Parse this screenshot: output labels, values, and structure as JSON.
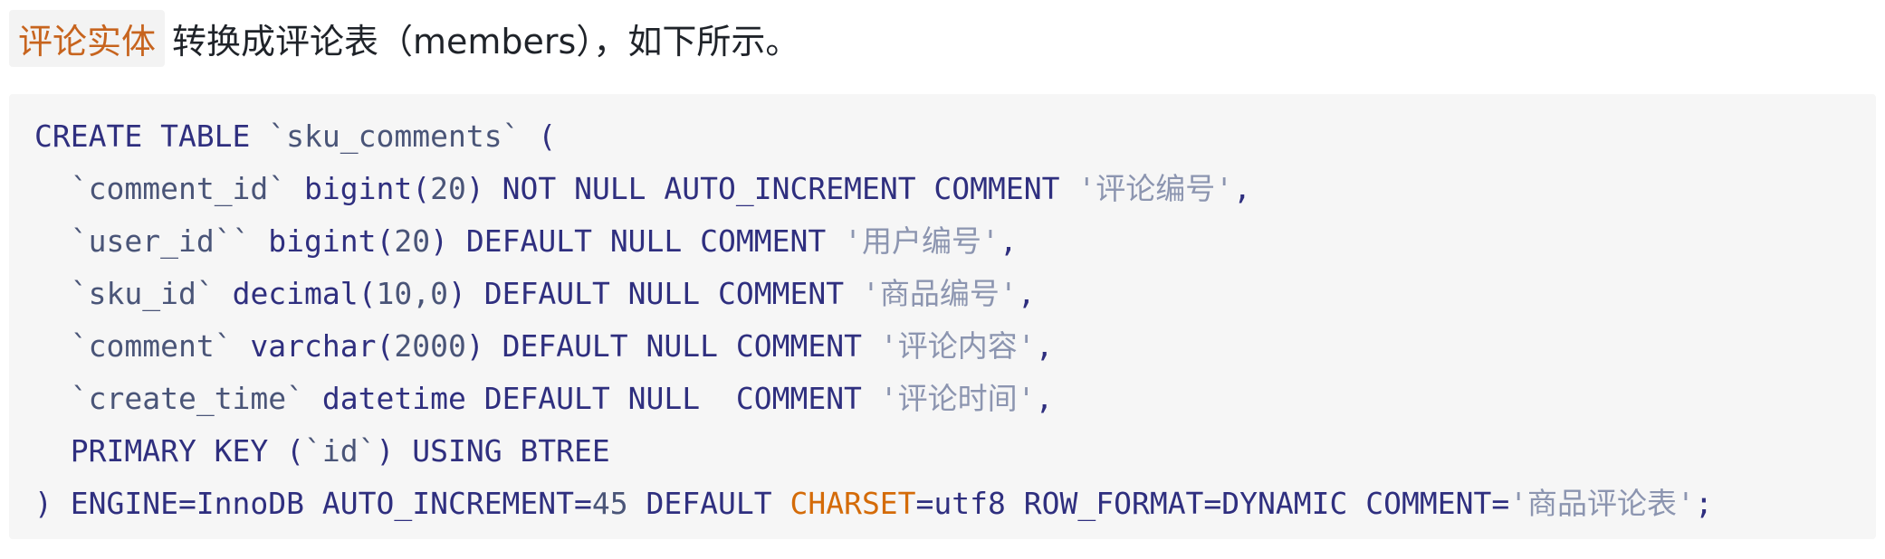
{
  "intro": {
    "inline_code": "评论实体",
    "rest": "转换成评论表（members），如下所示。"
  },
  "code": {
    "lines": [
      [
        {
          "t": "CREATE TABLE ",
          "c": "plain"
        },
        {
          "t": "`sku_comments`",
          "c": "ident"
        },
        {
          "t": " (",
          "c": "plain"
        }
      ],
      [
        {
          "t": "  ",
          "c": "plain"
        },
        {
          "t": "`comment_id`",
          "c": "ident"
        },
        {
          "t": " bigint(",
          "c": "plain"
        },
        {
          "t": "20",
          "c": "num"
        },
        {
          "t": ") NOT NULL AUTO_INCREMENT COMMENT ",
          "c": "plain"
        },
        {
          "t": "'评论编号'",
          "c": "str"
        },
        {
          "t": ",",
          "c": "plain"
        }
      ],
      [
        {
          "t": "  ",
          "c": "plain"
        },
        {
          "t": "`user_id``",
          "c": "ident"
        },
        {
          "t": " bigint(",
          "c": "plain"
        },
        {
          "t": "20",
          "c": "num"
        },
        {
          "t": ") DEFAULT NULL COMMENT ",
          "c": "plain"
        },
        {
          "t": "'用户编号'",
          "c": "str"
        },
        {
          "t": ",",
          "c": "plain"
        }
      ],
      [
        {
          "t": "  ",
          "c": "plain"
        },
        {
          "t": "`sku_id`",
          "c": "ident"
        },
        {
          "t": " decimal(",
          "c": "plain"
        },
        {
          "t": "10,0",
          "c": "num"
        },
        {
          "t": ") DEFAULT NULL COMMENT ",
          "c": "plain"
        },
        {
          "t": "'商品编号'",
          "c": "str"
        },
        {
          "t": ",",
          "c": "plain"
        }
      ],
      [
        {
          "t": "  ",
          "c": "plain"
        },
        {
          "t": "`comment`",
          "c": "ident"
        },
        {
          "t": " varchar(",
          "c": "plain"
        },
        {
          "t": "2000",
          "c": "num"
        },
        {
          "t": ") DEFAULT NULL COMMENT ",
          "c": "plain"
        },
        {
          "t": "'评论内容'",
          "c": "str"
        },
        {
          "t": ",",
          "c": "plain"
        }
      ],
      [
        {
          "t": "  ",
          "c": "plain"
        },
        {
          "t": "`create_time`",
          "c": "ident"
        },
        {
          "t": " datetime DEFAULT NULL  COMMENT ",
          "c": "plain"
        },
        {
          "t": "'评论时间'",
          "c": "str"
        },
        {
          "t": ",",
          "c": "plain"
        }
      ],
      [
        {
          "t": "  PRIMARY KEY (",
          "c": "plain"
        },
        {
          "t": "`id`",
          "c": "ident"
        },
        {
          "t": ") USING BTREE",
          "c": "plain"
        }
      ],
      [
        {
          "t": ") ENGINE=InnoDB AUTO_INCREMENT=",
          "c": "plain"
        },
        {
          "t": "45",
          "c": "num"
        },
        {
          "t": " DEFAULT ",
          "c": "plain"
        },
        {
          "t": "CHARSET",
          "c": "kw-orange"
        },
        {
          "t": "=utf8 ROW_FORMAT=DYNAMIC COMMENT=",
          "c": "plain"
        },
        {
          "t": "'商品评论表'",
          "c": "str"
        },
        {
          "t": ";",
          "c": "plain"
        }
      ]
    ]
  }
}
